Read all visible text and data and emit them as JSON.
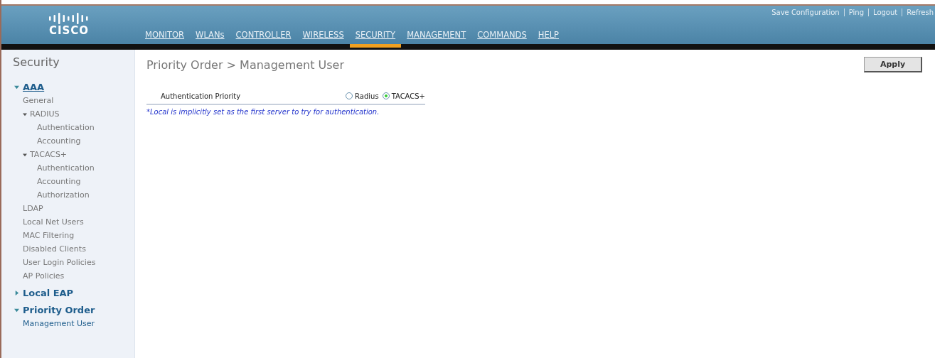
{
  "header": {
    "logo": "CISCO",
    "nav": [
      {
        "label": "MONITOR",
        "selected": false
      },
      {
        "label": "WLANs",
        "selected": false
      },
      {
        "label": "CONTROLLER",
        "selected": false
      },
      {
        "label": "WIRELESS",
        "selected": false
      },
      {
        "label": "SECURITY",
        "selected": true
      },
      {
        "label": "MANAGEMENT",
        "selected": false
      },
      {
        "label": "COMMANDS",
        "selected": false
      },
      {
        "label": "HELP",
        "selected": false
      }
    ],
    "links": [
      "Save Configuration",
      "Ping",
      "Logout",
      "Refresh"
    ]
  },
  "sidebar": {
    "title": "Security",
    "items": [
      {
        "label": "AAA",
        "expanded": true,
        "children": [
          {
            "label": "General"
          },
          {
            "label": "RADIUS",
            "expanded": true,
            "children": [
              {
                "label": "Authentication"
              },
              {
                "label": "Accounting"
              }
            ]
          },
          {
            "label": "TACACS+",
            "expanded": true,
            "children": [
              {
                "label": "Authentication"
              },
              {
                "label": "Accounting"
              },
              {
                "label": "Authorization"
              }
            ]
          },
          {
            "label": "LDAP"
          },
          {
            "label": "Local Net Users"
          },
          {
            "label": "MAC Filtering"
          },
          {
            "label": "Disabled Clients"
          },
          {
            "label": "User Login Policies"
          },
          {
            "label": "AP Policies"
          }
        ]
      },
      {
        "label": "Local EAP",
        "expanded": false
      },
      {
        "label": "Priority Order",
        "expanded": true,
        "children": [
          {
            "label": "Management User",
            "selected": true
          }
        ]
      }
    ]
  },
  "content": {
    "breadcrumb": "Priority Order > Management User",
    "apply": "Apply",
    "field": {
      "label": "Authentication Priority",
      "options": [
        {
          "label": "Radius",
          "selected": false
        },
        {
          "label": "TACACS+",
          "selected": true
        }
      ]
    },
    "note": "*Local is implicitly set as the first server to try for authentication."
  }
}
